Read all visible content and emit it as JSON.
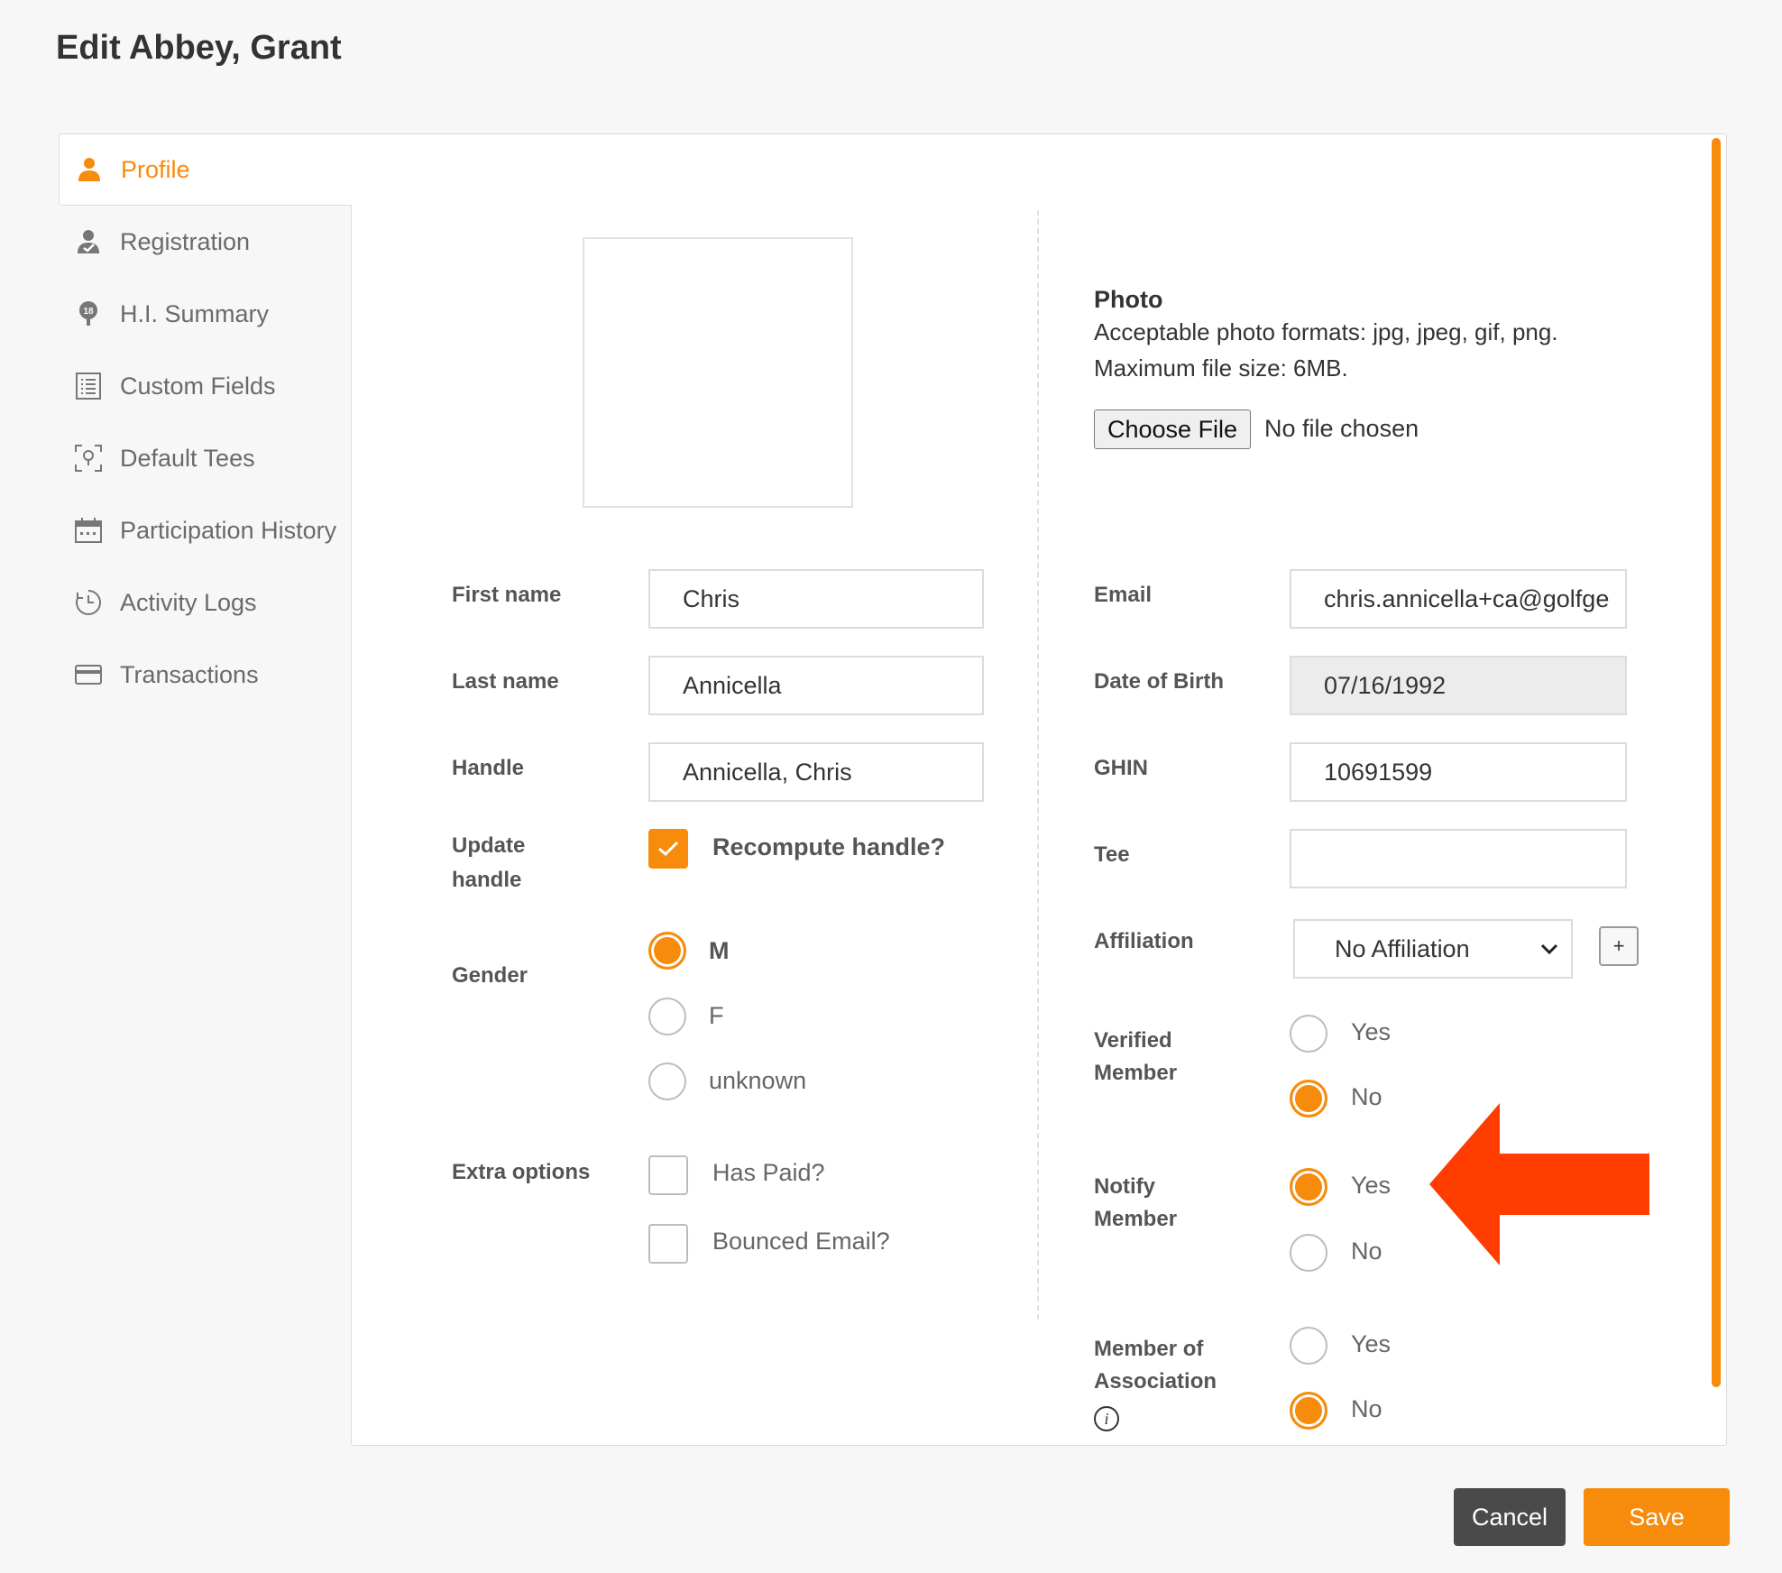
{
  "title": "Edit Abbey, Grant",
  "sidebar": {
    "items": [
      {
        "label": "Profile",
        "icon": "user-icon",
        "active": true
      },
      {
        "label": "Registration",
        "icon": "user-check-icon"
      },
      {
        "label": "H.I. Summary",
        "icon": "golf-ball-icon",
        "icon_text": "18"
      },
      {
        "label": "Custom Fields",
        "icon": "list-icon"
      },
      {
        "label": "Default Tees",
        "icon": "tee-marker-icon"
      },
      {
        "label": "Participation History",
        "icon": "calendar-icon"
      },
      {
        "label": "Activity Logs",
        "icon": "clock-icon"
      },
      {
        "label": "Transactions",
        "icon": "credit-card-icon"
      }
    ]
  },
  "photo": {
    "heading": "Photo",
    "formats": "Acceptable photo formats: jpg, jpeg, gif, png.",
    "max_size": "Maximum file size: 6MB.",
    "choose_label": "Choose File",
    "file_status": "No file chosen"
  },
  "form_left": {
    "first_name": {
      "label": "First name",
      "value": "Chris"
    },
    "last_name": {
      "label": "Last name",
      "value": "Annicella"
    },
    "handle": {
      "label": "Handle",
      "value": "Annicella, Chris"
    },
    "update_handle": {
      "label_line1": "Update",
      "label_line2": "handle",
      "option": "Recompute handle?",
      "checked": true
    },
    "gender": {
      "label": "Gender",
      "options": [
        "M",
        "F",
        "unknown"
      ],
      "selected": "M"
    },
    "extra_options": {
      "label": "Extra options",
      "options": [
        {
          "label": "Has Paid?",
          "checked": false
        },
        {
          "label": "Bounced Email?",
          "checked": false
        }
      ]
    }
  },
  "form_right": {
    "email": {
      "label": "Email",
      "value": "chris.annicella+ca@golfge"
    },
    "dob": {
      "label": "Date of Birth",
      "value": "07/16/1992"
    },
    "ghin": {
      "label": "GHIN",
      "value": "10691599"
    },
    "tee": {
      "label": "Tee",
      "value": ""
    },
    "affiliation": {
      "label": "Affiliation",
      "value": "No Affiliation",
      "add_label": "+"
    },
    "verified_member": {
      "label_line1": "Verified",
      "label_line2": "Member",
      "yes": "Yes",
      "no": "No",
      "selected": "No"
    },
    "notify_member": {
      "label_line1": "Notify",
      "label_line2": "Member",
      "yes": "Yes",
      "no": "No",
      "selected": "Yes"
    },
    "member_of_association": {
      "label_line1": "Member of",
      "label_line2": "Association",
      "info_icon": "i",
      "yes": "Yes",
      "no": "No",
      "selected": "No"
    }
  },
  "actions": {
    "cancel": "Cancel",
    "save": "Save"
  },
  "colors": {
    "accent": "#f78b0c",
    "arrow": "#ff3d00",
    "cancel": "#4a4a4a"
  }
}
